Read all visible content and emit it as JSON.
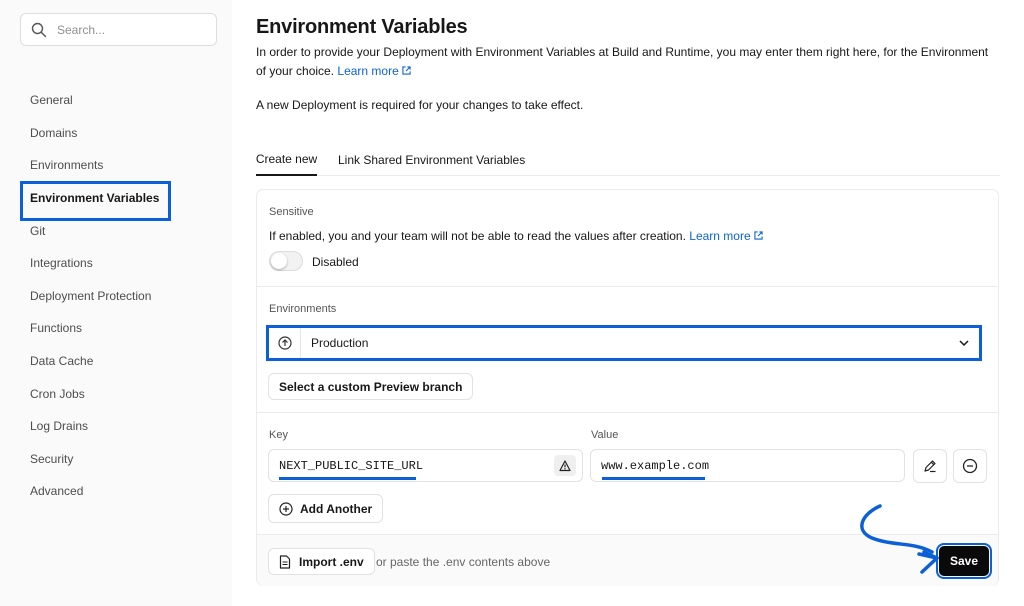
{
  "search": {
    "placeholder": "Search..."
  },
  "sidebar": {
    "items": [
      {
        "label": "General"
      },
      {
        "label": "Domains"
      },
      {
        "label": "Environments"
      },
      {
        "label": "Environment Variables"
      },
      {
        "label": "Git"
      },
      {
        "label": "Integrations"
      },
      {
        "label": "Deployment Protection"
      },
      {
        "label": "Functions"
      },
      {
        "label": "Data Cache"
      },
      {
        "label": "Cron Jobs"
      },
      {
        "label": "Log Drains"
      },
      {
        "label": "Security"
      },
      {
        "label": "Advanced"
      }
    ],
    "active_index": 3
  },
  "page": {
    "title": "Environment Variables",
    "intro": "In order to provide your Deployment with Environment Variables at Build and Runtime, you may enter them right here, for the Environment of your choice.",
    "learn_more": "Learn more",
    "notice": "A new Deployment is required for your changes to take effect."
  },
  "tabs": [
    {
      "label": "Create new"
    },
    {
      "label": "Link Shared Environment Variables"
    }
  ],
  "sensitive": {
    "label": "Sensitive",
    "description": "If enabled, you and your team will not be able to read the values after creation.",
    "learn_more": "Learn more",
    "state": "Disabled"
  },
  "environments": {
    "label": "Environments",
    "selected": "Production",
    "custom_branch_button": "Select a custom Preview branch"
  },
  "variable": {
    "key_label": "Key",
    "value_label": "Value",
    "key": "NEXT_PUBLIC_SITE_URL",
    "value": "www.example.com",
    "add_another": "Add Another"
  },
  "footer": {
    "import_button": "Import .env",
    "paste_hint": "or paste the .env contents above",
    "save": "Save"
  },
  "colors": {
    "accent": "#0b5fd7",
    "link": "#0b63d6",
    "primary_button": "#0a0a0a"
  }
}
